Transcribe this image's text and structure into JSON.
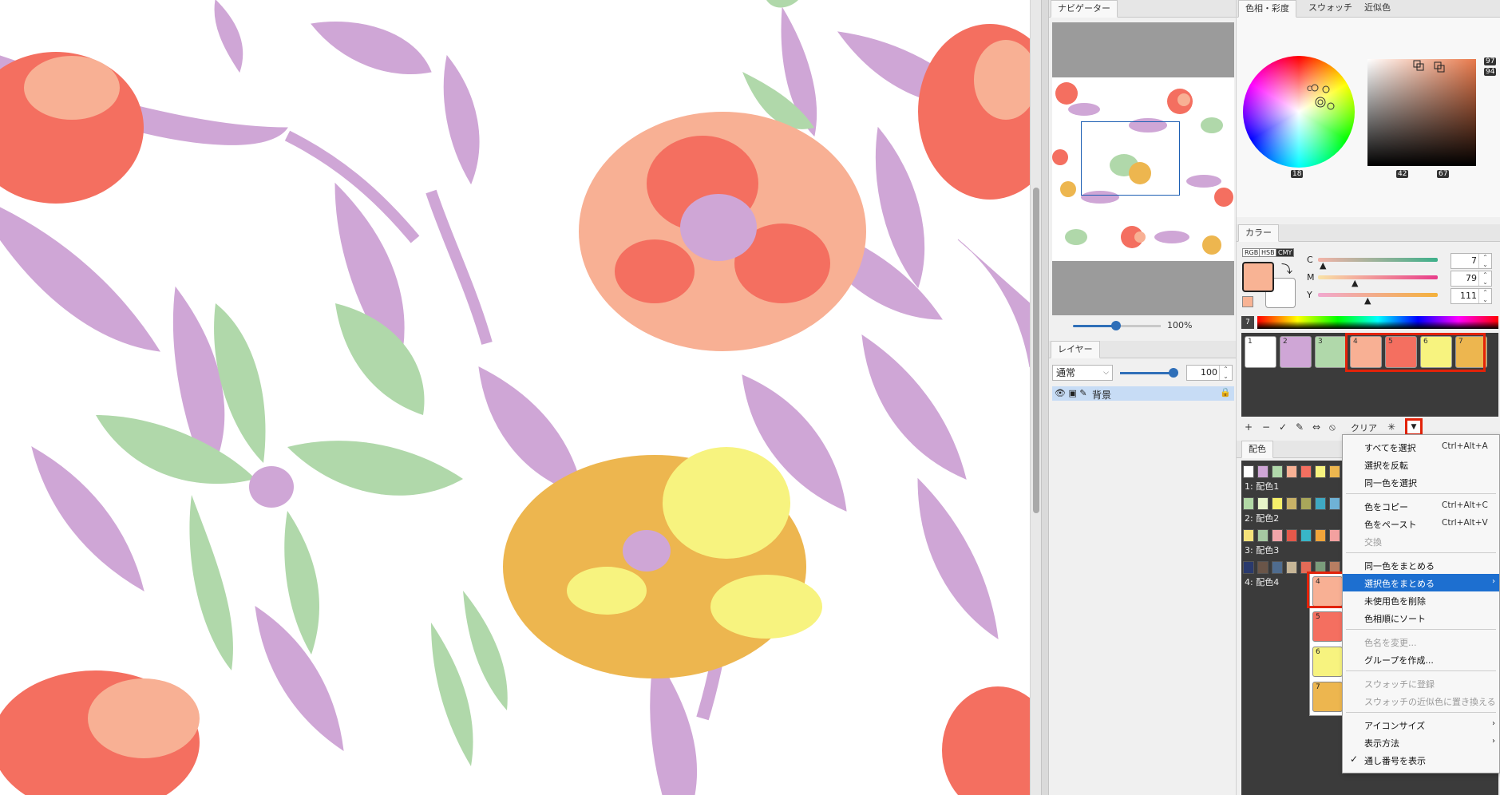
{
  "navigator": {
    "tab": "ナビゲーター",
    "zoom": "100%"
  },
  "layer": {
    "tab": "レイヤー",
    "blend_mode": "通常",
    "opacity": "100",
    "name": "背景"
  },
  "hue_panel": {
    "tabs": [
      "色相・彩度",
      "スウォッチ",
      "近似色"
    ],
    "hue": "18",
    "top_a": "97",
    "top_b": "94",
    "bottom_a": "42",
    "bottom_b": "67"
  },
  "color_panel": {
    "tab": "カラー",
    "modes": [
      "RGB",
      "HSB",
      "CMY"
    ],
    "main_color": "#f8b394",
    "sliders": [
      {
        "label": "C",
        "value": "7"
      },
      {
        "label": "M",
        "value": "79"
      },
      {
        "label": "Y",
        "value": "111"
      }
    ],
    "spectrum_index": "7"
  },
  "palette": {
    "swatches": [
      {
        "n": "1",
        "color": "#ffffff"
      },
      {
        "n": "2",
        "color": "#cfa6d6"
      },
      {
        "n": "3",
        "color": "#b0d8aa"
      },
      {
        "n": "4",
        "color": "#f8b094"
      },
      {
        "n": "5",
        "color": "#f46f60"
      },
      {
        "n": "6",
        "color": "#f7f37f"
      },
      {
        "n": "7",
        "color": "#edb64f"
      }
    ],
    "toolbar": {
      "add": "+",
      "remove": "−",
      "check": "✓",
      "edit": "✎",
      "swap": "⇔",
      "prohibit": "⦸",
      "clear": "クリア",
      "star": "✳",
      "dropdown": "▼"
    }
  },
  "harmony": {
    "tab": "配色",
    "sets": [
      {
        "name": "1: 配色1",
        "colors": [
          "#ffffff",
          "#cfa6d6",
          "#b0d8aa",
          "#f8b094",
          "#f46f60",
          "#f7f37f",
          "#edb64f"
        ]
      },
      {
        "name": "2: 配色2",
        "colors": [
          "#b2d9a6",
          "#e6f4c9",
          "#f6f06a",
          "#c9b267",
          "#a8a65a",
          "#3fa8c2",
          "#6fb2d6"
        ]
      },
      {
        "name": "3: 配色3",
        "colors": [
          "#f5e27a",
          "#a6c9a2",
          "#f2a4a9",
          "#e4584a",
          "#38b6c8",
          "#f1a53a",
          "#f3a1a0"
        ]
      },
      {
        "name": "4: 配色4",
        "colors": [
          "#2a3a6d",
          "#6a5548",
          "#4f6c8f",
          "#c7b697",
          "#e36b57",
          "#7a9c7b",
          "#b77e62"
        ]
      }
    ],
    "popout": [
      {
        "n": "4",
        "color": "#f8b094"
      },
      {
        "n": "5",
        "color": "#f46f60"
      },
      {
        "n": "6",
        "color": "#f7f37f"
      },
      {
        "n": "7",
        "color": "#edb64f"
      }
    ]
  },
  "menu": {
    "select_all": "すべてを選択",
    "select_all_sc": "Ctrl+Alt+A",
    "invert": "選択を反転",
    "select_same": "同一色を選択",
    "copy": "色をコピー",
    "copy_sc": "Ctrl+Alt+C",
    "paste": "色をペースト",
    "paste_sc": "Ctrl+Alt+V",
    "swap": "交換",
    "merge_same": "同一色をまとめる",
    "merge_selected": "選択色をまとめる",
    "delete_unused": "未使用色を削除",
    "sort_hue": "色相順にソート",
    "rename": "色名を変更...",
    "make_group": "グループを作成...",
    "register_swatch": "スウォッチに登録",
    "replace_near": "スウォッチの近似色に置き換える",
    "icon_size": "アイコンサイズ",
    "display_mode": "表示方法",
    "show_serial": "通し番号を表示"
  }
}
